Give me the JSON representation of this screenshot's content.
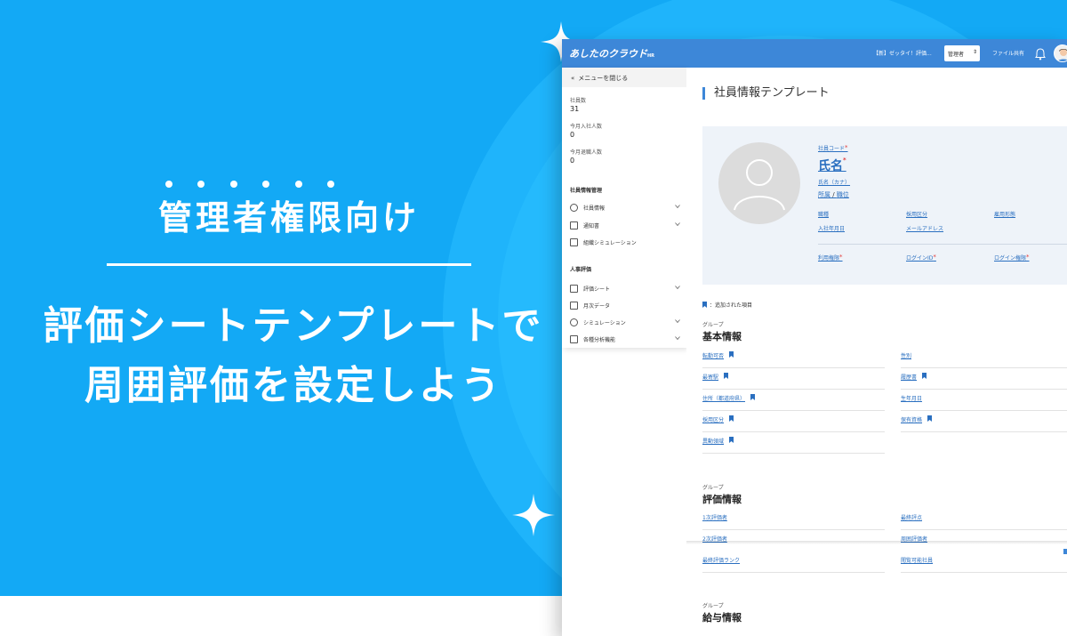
{
  "hero": {
    "tag": "管理者権限向け",
    "line1": "評価シートテンプレートで",
    "line2": "周囲評価を設定しよう"
  },
  "colors": {
    "brand_blue": "#13a9f5",
    "app_header": "#3d87d8",
    "link": "#2a6fc0",
    "required": "#e23a3a"
  },
  "header": {
    "logo": "あしたのクラウド",
    "logo_sub": "HR",
    "notice": "【新】ゼッタイ！評価...",
    "role": "管理者",
    "share": "ファイル共有",
    "bell_icon": "bell-icon"
  },
  "sidebar": {
    "close_menu": "メニューを閉じる",
    "stats": [
      {
        "label": "社員数",
        "value": "31"
      },
      {
        "label": "今月入社人数",
        "value": "0"
      },
      {
        "label": "今月退職人数",
        "value": "0"
      }
    ],
    "section1": "社員情報管理",
    "section1_items": [
      {
        "label": "社員情報",
        "icon": "person-icon"
      },
      {
        "label": "通知書",
        "icon": "document-icon"
      },
      {
        "label": "組織シミュレーション",
        "icon": "org-chart-icon"
      }
    ],
    "section2": "人事評価",
    "section2_items": [
      {
        "label": "評価シート",
        "icon": "checklist-icon"
      },
      {
        "label": "月次データ",
        "icon": "copy-icon"
      },
      {
        "label": "シミュレーション",
        "icon": "simulation-icon"
      },
      {
        "label": "各種分析機能",
        "icon": "bar-chart-icon"
      }
    ]
  },
  "main": {
    "title": "社員情報テンプレート",
    "profile": {
      "code": "社員コード",
      "name": "氏名",
      "kana": "氏名（カナ）",
      "dept": "所属",
      "sep": " / ",
      "position": "職位",
      "job": "職種",
      "hire_type": "採用区分",
      "employ_type": "雇用形態",
      "join_date": "入社年月日",
      "email": "メールアドレス",
      "permission": "利用権限",
      "login_id": "ログインID",
      "login_perm": "ログイン権限",
      "req": "*"
    },
    "legend": "：追加された項目",
    "group_label": "グループ",
    "groups": [
      {
        "title": "基本情報",
        "left": [
          "転勤可否",
          "最寄駅",
          "住所（都道府県）",
          "採用区分",
          "異動領域"
        ],
        "right": [
          "性別",
          "履歴書",
          "生年月日",
          "保有資格"
        ]
      },
      {
        "title": "評価情報",
        "left": [
          "1次評価者",
          "2次評価者",
          "最終評価ランク"
        ],
        "right": [
          "最終評点",
          "周囲評価者",
          "閲覧可能社員"
        ]
      },
      {
        "title": "給与情報"
      }
    ]
  }
}
